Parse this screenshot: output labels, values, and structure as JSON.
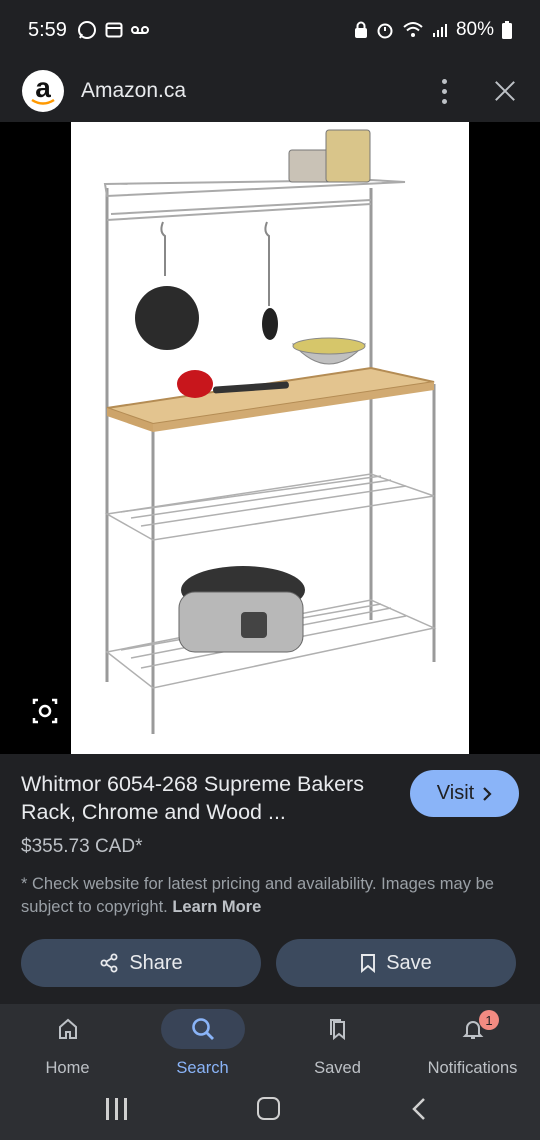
{
  "status_bar": {
    "time": "5:59",
    "battery": "80%"
  },
  "top_bar": {
    "logo_letter": "a",
    "site_name": "Amazon.ca"
  },
  "result": {
    "title": "Whitmor 6054-268 Supreme Bakers Rack, Chrome and Wood ...",
    "price": "$355.73 CAD*",
    "disclaimer": "* Check website for latest pricing and availability. Images may be subject to copyright.",
    "learn_more": "Learn More",
    "visit_label": "Visit",
    "share_label": "Share",
    "save_label": "Save"
  },
  "bottom_nav": {
    "items": [
      {
        "label": "Home",
        "icon": "home-icon"
      },
      {
        "label": "Search",
        "icon": "search-icon",
        "active": true
      },
      {
        "label": "Saved",
        "icon": "saved-icon"
      },
      {
        "label": "Notifications",
        "icon": "bell-icon",
        "badge": "1"
      }
    ]
  },
  "colors": {
    "background": "#202124",
    "accent": "#8ab4f8",
    "button": "#3c4a5e",
    "badge": "#f28b82"
  }
}
